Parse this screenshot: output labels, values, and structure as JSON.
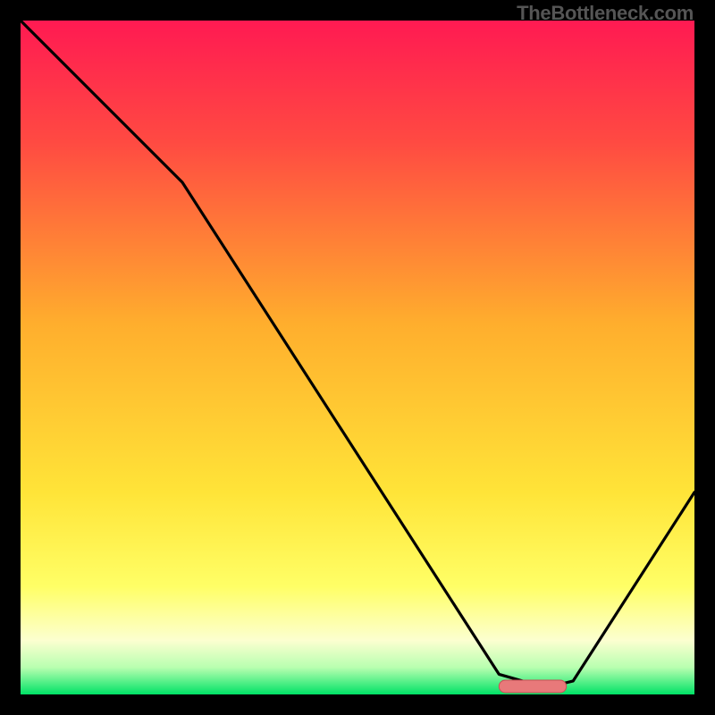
{
  "watermark": "TheBottleneck.com",
  "colors": {
    "bg": "#000000",
    "gradient_top": "#ff1a52",
    "gradient_mid": "#ffae2d",
    "gradient_low": "#ffff66",
    "gradient_pale": "#fcffd0",
    "gradient_green": "#00e266",
    "line": "#000000",
    "marker_fill": "#e8797a",
    "marker_stroke": "#c94f57"
  },
  "chart_data": {
    "type": "line",
    "title": "",
    "xlabel": "",
    "ylabel": "",
    "xlim": [
      0,
      100
    ],
    "ylim": [
      0,
      100
    ],
    "series": [
      {
        "name": "bottleneck-curve",
        "x": [
          0,
          24,
          71,
          78,
          82,
          100
        ],
        "values": [
          100,
          76,
          3,
          1,
          2,
          30
        ]
      }
    ],
    "marker": {
      "x_start": 71,
      "x_end": 81,
      "y": 1.2
    }
  }
}
